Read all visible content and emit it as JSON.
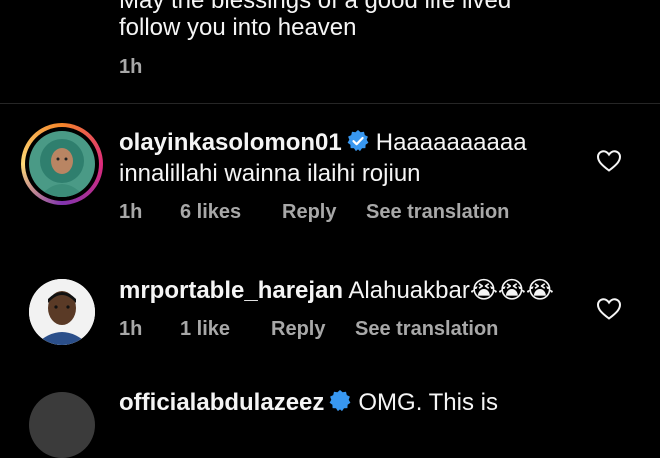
{
  "top_comment": {
    "line1": "May the blessings of a good life lived",
    "line2": "follow you into heaven",
    "time": "1h"
  },
  "comments": [
    {
      "username": "olayinkasolomon01",
      "text_line1": "Haaaaaaaaaa",
      "text_line2": "innalillahi wainna ilaihi rojiun",
      "time": "1h",
      "likes": "6 likes",
      "reply": "Reply",
      "translate": "See translation",
      "verified": true
    },
    {
      "username": "mrportable_harejan",
      "text": "Alahuakbar",
      "emojis": "😭😭😭",
      "time": "1h",
      "likes": "1 like",
      "reply": "Reply",
      "translate": "See translation",
      "verified": false
    }
  ],
  "bottom_partial": {
    "username": "officialabdulazeez",
    "text": "OMG. This is"
  },
  "colors": {
    "background": "#000000",
    "text": "#f5f5f5",
    "meta": "#a8a8a8",
    "verified": "#3897f0"
  }
}
